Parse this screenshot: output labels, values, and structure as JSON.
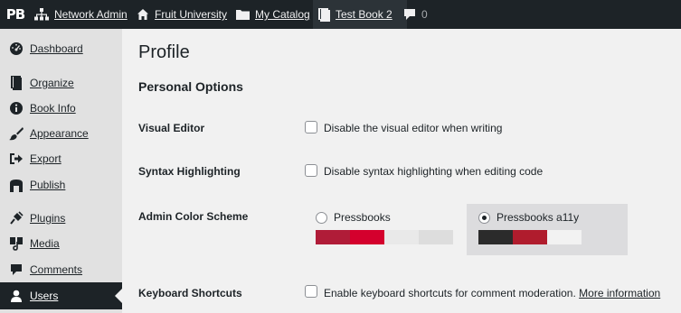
{
  "adminbar": {
    "logo": "PB",
    "network_admin": "Network Admin",
    "site": "Fruit University",
    "catalog": "My Catalog",
    "book": "Test Book 2",
    "comments_count": "0",
    "icons": [
      "network-icon",
      "home-icon",
      "folder-icon",
      "book-icon",
      "comment-bubble-icon"
    ]
  },
  "sidebar": {
    "items": [
      {
        "label": "Dashboard",
        "icon": "dashboard-icon"
      },
      {
        "label": "Organize",
        "icon": "book-icon"
      },
      {
        "label": "Book Info",
        "icon": "info-icon"
      },
      {
        "label": "Appearance",
        "icon": "paintbrush-icon"
      },
      {
        "label": "Export",
        "icon": "export-icon"
      },
      {
        "label": "Publish",
        "icon": "shop-icon"
      },
      {
        "label": "Plugins",
        "icon": "plugin-icon"
      },
      {
        "label": "Media",
        "icon": "media-icon"
      },
      {
        "label": "Comments",
        "icon": "comment-icon"
      },
      {
        "label": "Users",
        "icon": "users-icon",
        "current": true
      }
    ]
  },
  "main": {
    "title": "Profile",
    "section": "Personal Options",
    "visual_editor": {
      "label": "Visual Editor",
      "option": "Disable the visual editor when writing",
      "checked": false
    },
    "syntax": {
      "label": "Syntax Highlighting",
      "option": "Disable syntax highlighting when editing code",
      "checked": false
    },
    "color_scheme": {
      "label": "Admin Color Scheme",
      "options": [
        {
          "name": "Pressbooks",
          "selected": false,
          "colors": [
            "#b01c38",
            "#d4002d",
            "#e9e9e9",
            "#dddddd"
          ]
        },
        {
          "name": "Pressbooks a11y",
          "selected": true,
          "colors": [
            "#2b2b2b",
            "#4a4a4a",
            "#b01c2d",
            "#f2f2f2"
          ]
        }
      ]
    },
    "shortcuts": {
      "label": "Keyboard Shortcuts",
      "option": "Enable keyboard shortcuts for comment moderation.",
      "link": "More information",
      "checked": false
    }
  },
  "colors": {
    "adminbar_bg": "#1d2327",
    "sidebar_bg": "#e1e1e1",
    "content_bg": "#f1f1f1",
    "selected_scheme_bg": "#dcdcde"
  }
}
